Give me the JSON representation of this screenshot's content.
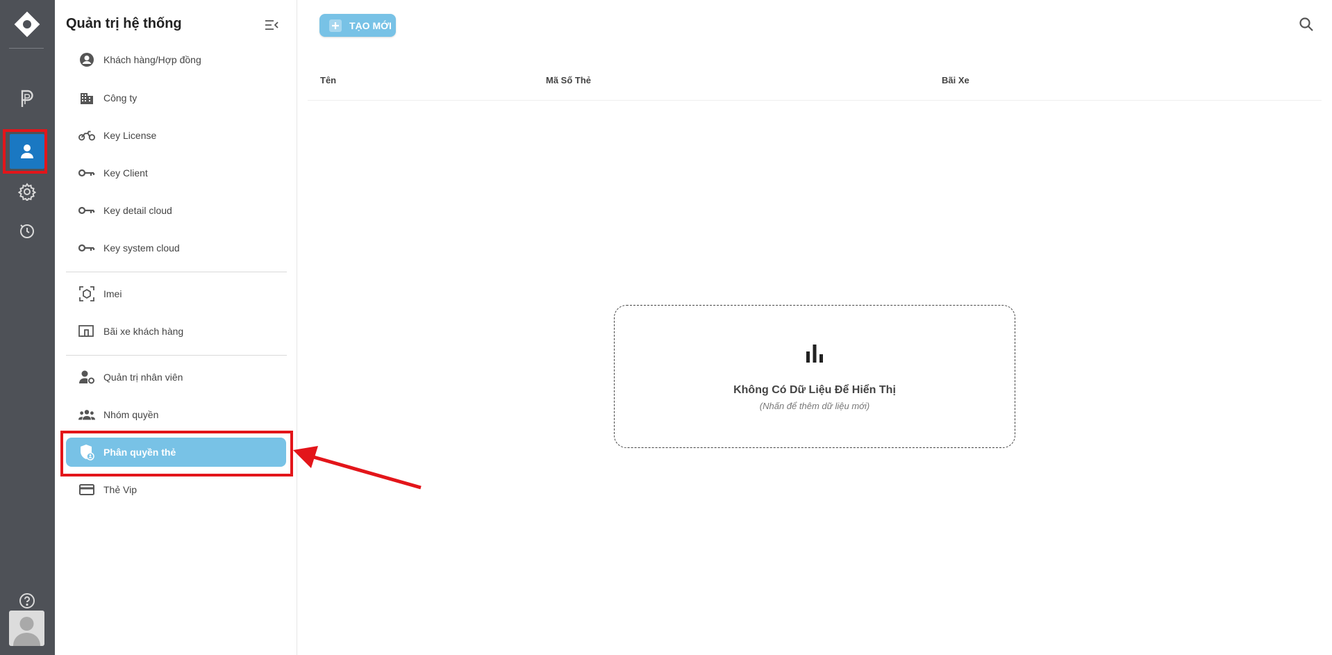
{
  "sidebar": {
    "title": "Quản trị hệ thống",
    "items": [
      {
        "label": "Khách hàng/Hợp đồng",
        "icon": "account-circle-icon"
      },
      {
        "label": "Công ty",
        "icon": "building-icon"
      },
      {
        "label": "Key License",
        "icon": "motorbike-icon"
      },
      {
        "label": "Key Client",
        "icon": "key-icon"
      },
      {
        "label": "Key detail cloud",
        "icon": "key-icon"
      },
      {
        "label": "Key system cloud",
        "icon": "key-icon"
      },
      {
        "label": "Imei",
        "icon": "imei-scan-icon"
      },
      {
        "label": "Bãi xe khách hàng",
        "icon": "devices-icon"
      },
      {
        "label": "Quản trị nhân viên",
        "icon": "user-settings-icon"
      },
      {
        "label": "Nhóm quyền",
        "icon": "group-icon"
      },
      {
        "label": "Phân quyền thẻ",
        "icon": "shield-user-icon"
      },
      {
        "label": "Thẻ Vip",
        "icon": "credit-card-icon"
      }
    ],
    "active_item": "Phân quyền thẻ"
  },
  "toolbar": {
    "create_label": "TẠO MỚI"
  },
  "table": {
    "columns": [
      "Tên",
      "Mã Số Thẻ",
      "Bãi Xe"
    ]
  },
  "empty_state": {
    "title": "Không Có Dữ Liệu Để Hiển Thị",
    "subtitle": "(Nhấn để thêm dữ liệu mới)"
  },
  "rail": {
    "icons": [
      "parking-icon",
      "dashboard-grid-icon",
      "user-icon",
      "gear-icon",
      "history-icon",
      "help-icon"
    ],
    "active": "user-icon"
  },
  "colors": {
    "rail_bg": "#4e5157",
    "rail_active": "#1a78c2",
    "accent": "#78c2e6",
    "annotation_red": "#e3151a"
  }
}
